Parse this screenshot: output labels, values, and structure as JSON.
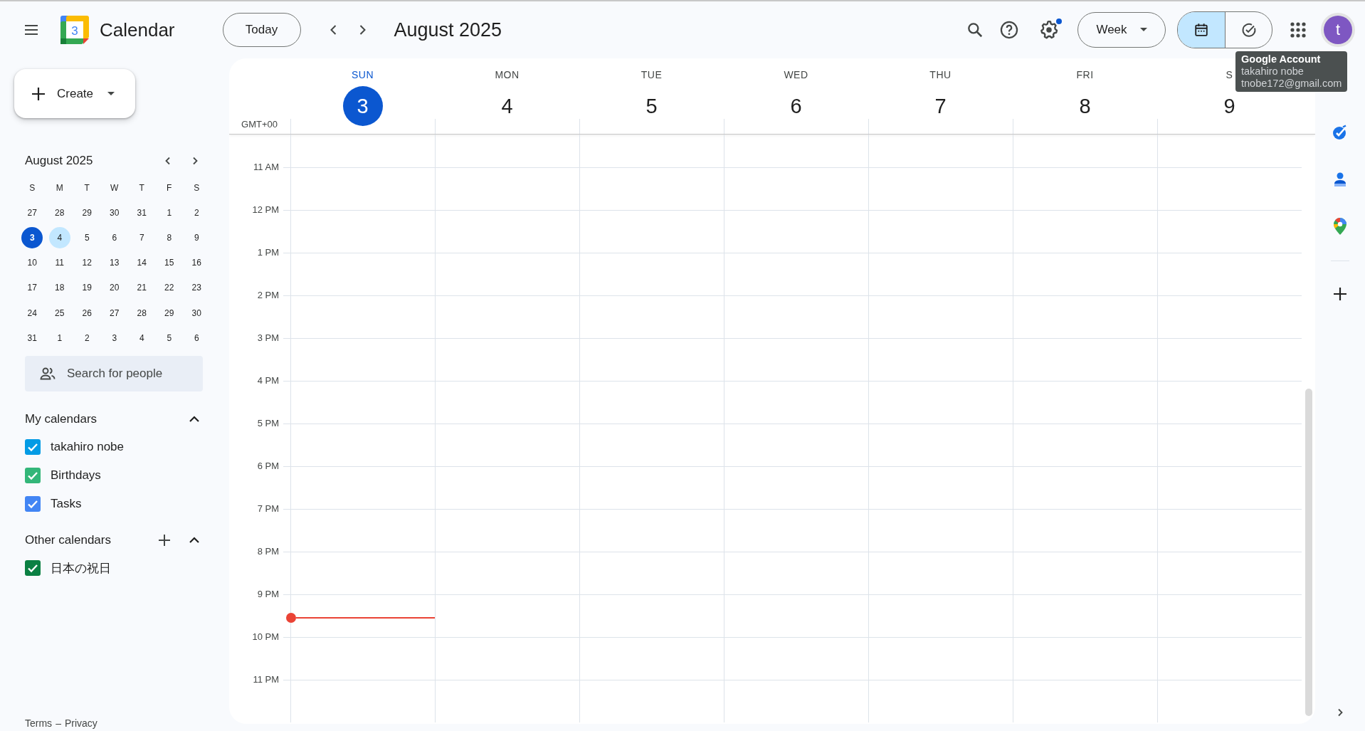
{
  "topbar": {
    "app_name": "Calendar",
    "logo_day": "3",
    "today_button": "Today",
    "period": "August 2025",
    "settings_badge": true,
    "view_select": "Week",
    "view_modes": [
      {
        "kind": "calendar",
        "selected": true
      },
      {
        "kind": "tasks",
        "selected": false
      }
    ],
    "avatar": {
      "initial": "t",
      "color": "#7e57c2"
    }
  },
  "tooltip": {
    "title": "Google Account",
    "lines": [
      "takahiro nobe",
      "tnobe172@gmail.com"
    ]
  },
  "sidebar": {
    "create_button": "Create",
    "mini_calendar": {
      "title": "August 2025",
      "weekdays": [
        "S",
        "M",
        "T",
        "W",
        "T",
        "F",
        "S"
      ],
      "weeks": [
        [
          {
            "day": "27",
            "today": false,
            "highlighted": false
          },
          {
            "day": "28",
            "today": false,
            "highlighted": false
          },
          {
            "day": "29",
            "today": false,
            "highlighted": false
          },
          {
            "day": "30",
            "today": false,
            "highlighted": false
          },
          {
            "day": "31",
            "today": false,
            "highlighted": false
          },
          {
            "day": "1",
            "today": false,
            "highlighted": false
          },
          {
            "day": "2",
            "today": false,
            "highlighted": false
          }
        ],
        [
          {
            "day": "3",
            "today": true,
            "highlighted": false
          },
          {
            "day": "4",
            "today": false,
            "highlighted": true
          },
          {
            "day": "5",
            "today": false,
            "highlighted": false
          },
          {
            "day": "6",
            "today": false,
            "highlighted": false
          },
          {
            "day": "7",
            "today": false,
            "highlighted": false
          },
          {
            "day": "8",
            "today": false,
            "highlighted": false
          },
          {
            "day": "9",
            "today": false,
            "highlighted": false
          }
        ],
        [
          {
            "day": "10",
            "today": false,
            "highlighted": false
          },
          {
            "day": "11",
            "today": false,
            "highlighted": false
          },
          {
            "day": "12",
            "today": false,
            "highlighted": false
          },
          {
            "day": "13",
            "today": false,
            "highlighted": false
          },
          {
            "day": "14",
            "today": false,
            "highlighted": false
          },
          {
            "day": "15",
            "today": false,
            "highlighted": false
          },
          {
            "day": "16",
            "today": false,
            "highlighted": false
          }
        ],
        [
          {
            "day": "17",
            "today": false,
            "highlighted": false
          },
          {
            "day": "18",
            "today": false,
            "highlighted": false
          },
          {
            "day": "19",
            "today": false,
            "highlighted": false
          },
          {
            "day": "20",
            "today": false,
            "highlighted": false
          },
          {
            "day": "21",
            "today": false,
            "highlighted": false
          },
          {
            "day": "22",
            "today": false,
            "highlighted": false
          },
          {
            "day": "23",
            "today": false,
            "highlighted": false
          }
        ],
        [
          {
            "day": "24",
            "today": false,
            "highlighted": false
          },
          {
            "day": "25",
            "today": false,
            "highlighted": false
          },
          {
            "day": "26",
            "today": false,
            "highlighted": false
          },
          {
            "day": "27",
            "today": false,
            "highlighted": false
          },
          {
            "day": "28",
            "today": false,
            "highlighted": false
          },
          {
            "day": "29",
            "today": false,
            "highlighted": false
          },
          {
            "day": "30",
            "today": false,
            "highlighted": false
          }
        ],
        [
          {
            "day": "31",
            "today": false,
            "highlighted": false
          },
          {
            "day": "1",
            "today": false,
            "highlighted": false
          },
          {
            "day": "2",
            "today": false,
            "highlighted": false
          },
          {
            "day": "3",
            "today": false,
            "highlighted": false
          },
          {
            "day": "4",
            "today": false,
            "highlighted": false
          },
          {
            "day": "5",
            "today": false,
            "highlighted": false
          },
          {
            "day": "6",
            "today": false,
            "highlighted": false
          }
        ]
      ]
    },
    "people_search": {
      "placeholder": "Search for people"
    },
    "calendar_groups": [
      {
        "title": "My calendars",
        "expanded": true,
        "can_add": false,
        "items": [
          {
            "label": "takahiro nobe",
            "checked": true,
            "color": "#039be5"
          },
          {
            "label": "Birthdays",
            "checked": true,
            "color": "#33b679"
          },
          {
            "label": "Tasks",
            "checked": true,
            "color": "#4285f4"
          }
        ]
      },
      {
        "title": "Other calendars",
        "expanded": true,
        "can_add": true,
        "items": [
          {
            "label": "日本の祝日",
            "checked": true,
            "color": "#0b8043"
          }
        ]
      }
    ],
    "footer": {
      "links": [
        "Terms",
        "Privacy"
      ],
      "separator": "–"
    }
  },
  "week_view": {
    "timezone": "GMT+00",
    "days": [
      {
        "weekday": "SUN",
        "date": "3",
        "today": true
      },
      {
        "weekday": "MON",
        "date": "4",
        "today": false
      },
      {
        "weekday": "TUE",
        "date": "5",
        "today": false
      },
      {
        "weekday": "WED",
        "date": "6",
        "today": false
      },
      {
        "weekday": "THU",
        "date": "7",
        "today": false
      },
      {
        "weekday": "FRI",
        "date": "8",
        "today": false
      },
      {
        "weekday": "S",
        "date": "9",
        "today": false
      }
    ],
    "hours": [
      "11 AM",
      "12 PM",
      "1 PM",
      "2 PM",
      "3 PM",
      "4 PM",
      "5 PM",
      "6 PM",
      "7 PM",
      "8 PM",
      "9 PM",
      "10 PM",
      "11 PM"
    ]
  }
}
